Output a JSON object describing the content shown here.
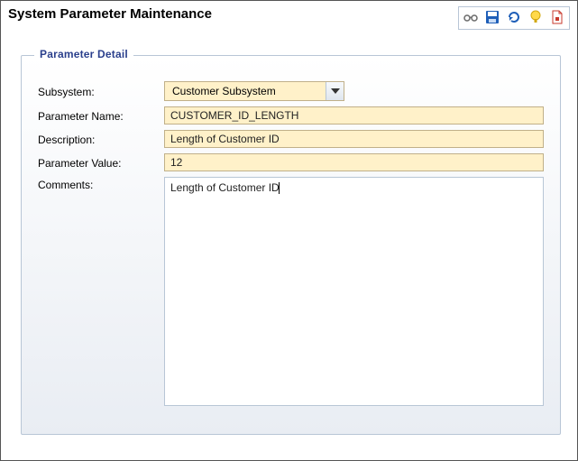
{
  "header": {
    "title": "System Parameter Maintenance"
  },
  "toolbar": {
    "items": [
      {
        "name": "glasses-icon",
        "title": "View"
      },
      {
        "name": "save-icon",
        "title": "Save"
      },
      {
        "name": "refresh-icon",
        "title": "Refresh"
      },
      {
        "name": "help-icon",
        "title": "Help"
      },
      {
        "name": "new-icon",
        "title": "New"
      }
    ]
  },
  "panel": {
    "legend": "Parameter Detail"
  },
  "form": {
    "subsystem": {
      "label": "Subsystem:",
      "value": "Customer Subsystem"
    },
    "parameter_name": {
      "label": "Parameter Name:",
      "value": "CUSTOMER_ID_LENGTH"
    },
    "description": {
      "label": "Description:",
      "value": "Length of Customer ID"
    },
    "parameter_value": {
      "label": "Parameter Value:",
      "value": "12"
    },
    "comments": {
      "label": "Comments:",
      "value": "Length of Customer ID"
    }
  }
}
